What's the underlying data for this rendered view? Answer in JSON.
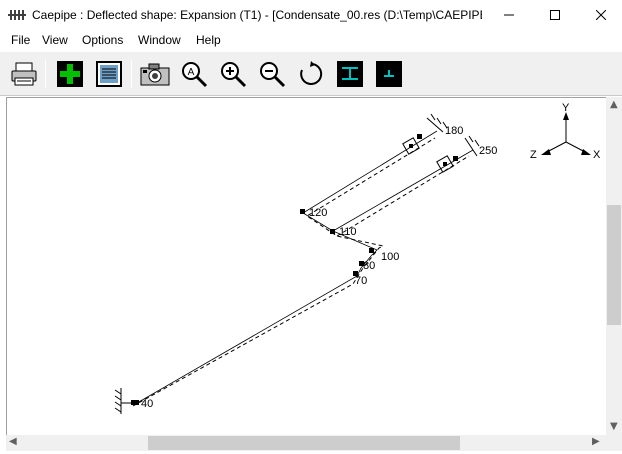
{
  "window": {
    "title": "Caepipe : Deflected shape: Expansion (T1) -   [Condensate_00.res (D:\\Temp\\CAEPIPE..."
  },
  "menu": {
    "items": [
      "File",
      "View",
      "Options",
      "Window",
      "Help"
    ]
  },
  "toolbar": {
    "buttons": [
      "print-icon",
      "add-green-icon",
      "list-icon",
      "camera-icon",
      "zoom-all-icon",
      "zoom-in-icon",
      "zoom-out-icon",
      "rotate-icon",
      "pipe-tee-icon",
      "pipe-support-icon"
    ]
  },
  "plot": {
    "nodes": [
      "180",
      "250",
      "120",
      "110",
      "100",
      "80",
      "70",
      "40"
    ],
    "axes": {
      "x": "X",
      "y": "Y",
      "z": "Z"
    }
  },
  "colors": {
    "accent_green": "#00c000",
    "icon_dark": "#000000",
    "icon_teal": "#008080"
  }
}
